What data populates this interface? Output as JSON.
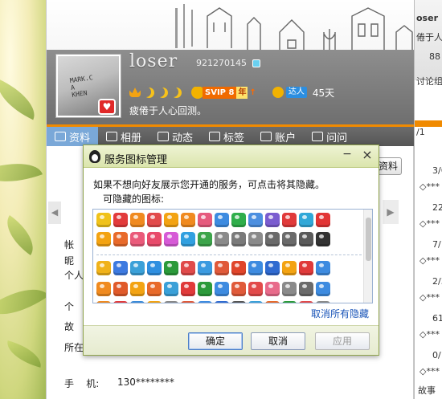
{
  "profile": {
    "nickname": "loser",
    "qq_number": "921270145",
    "signature": "疲倦于人心回测。",
    "vip_text": "SVIP 8",
    "vip_year": "年",
    "vip_arrow": "↑",
    "talent_label": "达人",
    "talent_days": "45天",
    "avatar_text": "MARK.C\nA\nKHEN"
  },
  "tabs": [
    {
      "label": "资料",
      "icon": "profile-card-icon"
    },
    {
      "label": "相册",
      "icon": "photo-icon"
    },
    {
      "label": "动态",
      "icon": "feed-icon"
    },
    {
      "label": "标签",
      "icon": "tag-icon"
    },
    {
      "label": "账户",
      "icon": "wallet-icon"
    },
    {
      "label": "问问",
      "icon": "question-icon"
    }
  ],
  "profile_fields": {
    "row1": "帐",
    "row2": "昵",
    "row3": "个人",
    "row4": "个",
    "row5": "故",
    "row6": "所在",
    "phone_label": "手    机:",
    "phone_value": "130********",
    "edit_label": "资料"
  },
  "right_panel": {
    "lines": [
      "oser",
      "倦于人心",
      "88",
      "讨论组",
      "/1",
      "3/6",
      "◇***",
      "22",
      "◇***",
      "7/1",
      "◇***",
      "2/3",
      "◇***",
      "61",
      "◇***",
      "0/1",
      "◇***",
      "故事"
    ]
  },
  "dialog": {
    "title": "服务图标管理",
    "description": "如果不想向好友展示您开通的服务，可点击将其隐藏。",
    "hint": "可隐藏的图标:",
    "unhide_all": "取消所有隐藏",
    "ok_label": "确定",
    "cancel_label": "取消",
    "apply_label": "应用",
    "min_label": "−",
    "close_label": "×"
  },
  "service_icons": {
    "row1_colors": [
      "#f0c21a",
      "#e23b3b",
      "#f08a1f",
      "#e24a4a",
      "#f3a312",
      "#f08a1f",
      "#e65a7d",
      "#3d8be0",
      "#2fae4a",
      "#4c8fe0",
      "#7a5ccf",
      "#e03a3a",
      "#31a8d8",
      "#e23535"
    ],
    "row2_colors": [
      "#f3a312",
      "#e86a2a",
      "#ea5a7a",
      "#e84a6a",
      "#d65ad6",
      "#31a0e0",
      "#3ca44a",
      "#8a8a8a",
      "#7a7a7a",
      "#8a8a8a",
      "#6a6a6a",
      "#6a6a6a",
      "#5a5a5a",
      "#333333"
    ],
    "row3_colors": [
      "#f0b21a",
      "#3d7ae0",
      "#3aa0d8",
      "#2f8fe0",
      "#2b9a3a",
      "#e04a4a",
      "#3b9ae0",
      "#e05a3a",
      "#e0452a",
      "#3d8be0",
      "#2f6ad0",
      "#f3a312",
      "#e03a3a",
      "#3d8be0"
    ],
    "row4_colors": [
      "#f08a1f",
      "#e05a2a",
      "#f3a312",
      "#e86a2a",
      "#3aa0d8",
      "#e03a3a",
      "#2b9a3a",
      "#3d8be0",
      "#e05a3a",
      "#e24a4a",
      "#e86a8a",
      "#8a8a8a",
      "#6a6a6a",
      "#3d8be0"
    ],
    "row5_colors": [
      "#f08a1f",
      "#e23b3b",
      "#3a8ad8",
      "#f3a312",
      "#888888",
      "#e05a3a",
      "#3d8be0",
      "#2f6ad0",
      "#555555",
      "#3aa0d8",
      "#e86a2a",
      "#2b9a3a",
      "#e24a4a",
      "#8a8a8a"
    ]
  }
}
